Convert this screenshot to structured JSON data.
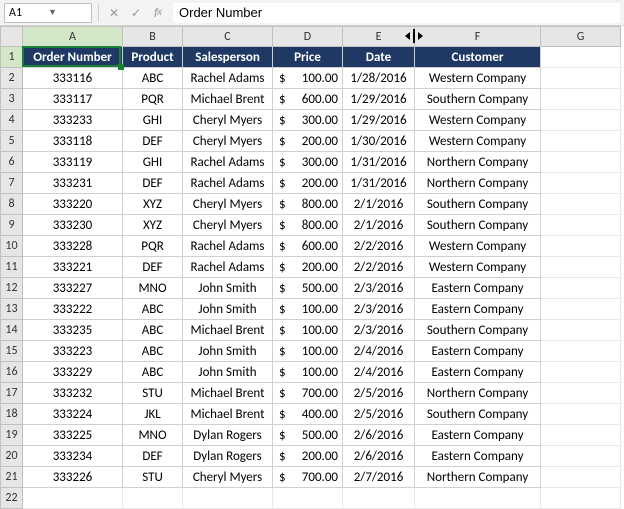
{
  "name_box": {
    "value": "A1"
  },
  "formula_bar": {
    "value": "Order Number"
  },
  "columns": [
    "A",
    "B",
    "C",
    "D",
    "E",
    "F",
    "G"
  ],
  "active_cell": "A1",
  "headers": [
    "Order Number",
    "Product",
    "Salesperson",
    "Price",
    "Date",
    "Customer"
  ],
  "currency": "$",
  "rows": [
    {
      "n": 1
    },
    {
      "n": 2,
      "order": "333116",
      "product": "ABC",
      "sales": "Rachel Adams",
      "price": "100.00",
      "date": "1/28/2016",
      "cust": "Western Company"
    },
    {
      "n": 3,
      "order": "333117",
      "product": "PQR",
      "sales": "Michael Brent",
      "price": "600.00",
      "date": "1/29/2016",
      "cust": "Southern Company"
    },
    {
      "n": 4,
      "order": "333233",
      "product": "GHI",
      "sales": "Cheryl Myers",
      "price": "300.00",
      "date": "1/29/2016",
      "cust": "Western Company"
    },
    {
      "n": 5,
      "order": "333118",
      "product": "DEF",
      "sales": "Cheryl Myers",
      "price": "200.00",
      "date": "1/30/2016",
      "cust": "Western Company"
    },
    {
      "n": 6,
      "order": "333119",
      "product": "GHI",
      "sales": "Rachel Adams",
      "price": "300.00",
      "date": "1/31/2016",
      "cust": "Northern Company"
    },
    {
      "n": 7,
      "order": "333231",
      "product": "DEF",
      "sales": "Rachel Adams",
      "price": "200.00",
      "date": "1/31/2016",
      "cust": "Northern Company"
    },
    {
      "n": 8,
      "order": "333220",
      "product": "XYZ",
      "sales": "Cheryl Myers",
      "price": "800.00",
      "date": "2/1/2016",
      "cust": "Southern Company"
    },
    {
      "n": 9,
      "order": "333230",
      "product": "XYZ",
      "sales": "Cheryl Myers",
      "price": "800.00",
      "date": "2/1/2016",
      "cust": "Southern Company"
    },
    {
      "n": 10,
      "order": "333228",
      "product": "PQR",
      "sales": "Rachel Adams",
      "price": "600.00",
      "date": "2/2/2016",
      "cust": "Western Company"
    },
    {
      "n": 11,
      "order": "333221",
      "product": "DEF",
      "sales": "Rachel Adams",
      "price": "200.00",
      "date": "2/2/2016",
      "cust": "Western Company"
    },
    {
      "n": 12,
      "order": "333227",
      "product": "MNO",
      "sales": "John Smith",
      "price": "500.00",
      "date": "2/3/2016",
      "cust": "Eastern Company"
    },
    {
      "n": 13,
      "order": "333222",
      "product": "ABC",
      "sales": "John Smith",
      "price": "100.00",
      "date": "2/3/2016",
      "cust": "Eastern Company"
    },
    {
      "n": 14,
      "order": "333235",
      "product": "ABC",
      "sales": "Michael Brent",
      "price": "100.00",
      "date": "2/3/2016",
      "cust": "Southern Company"
    },
    {
      "n": 15,
      "order": "333223",
      "product": "ABC",
      "sales": "John Smith",
      "price": "100.00",
      "date": "2/4/2016",
      "cust": "Eastern Company"
    },
    {
      "n": 16,
      "order": "333229",
      "product": "ABC",
      "sales": "John Smith",
      "price": "100.00",
      "date": "2/4/2016",
      "cust": "Eastern Company"
    },
    {
      "n": 17,
      "order": "333232",
      "product": "STU",
      "sales": "Michael Brent",
      "price": "700.00",
      "date": "2/5/2016",
      "cust": "Northern Company"
    },
    {
      "n": 18,
      "order": "333224",
      "product": "JKL",
      "sales": "Michael Brent",
      "price": "400.00",
      "date": "2/5/2016",
      "cust": "Southern Company"
    },
    {
      "n": 19,
      "order": "333225",
      "product": "MNO",
      "sales": "Dylan Rogers",
      "price": "500.00",
      "date": "2/6/2016",
      "cust": "Eastern Company"
    },
    {
      "n": 20,
      "order": "333234",
      "product": "DEF",
      "sales": "Dylan Rogers",
      "price": "200.00",
      "date": "2/6/2016",
      "cust": "Eastern Company"
    },
    {
      "n": 21,
      "order": "333226",
      "product": "STU",
      "sales": "Cheryl Myers",
      "price": "700.00",
      "date": "2/7/2016",
      "cust": "Northern Company"
    },
    {
      "n": 22
    }
  ]
}
